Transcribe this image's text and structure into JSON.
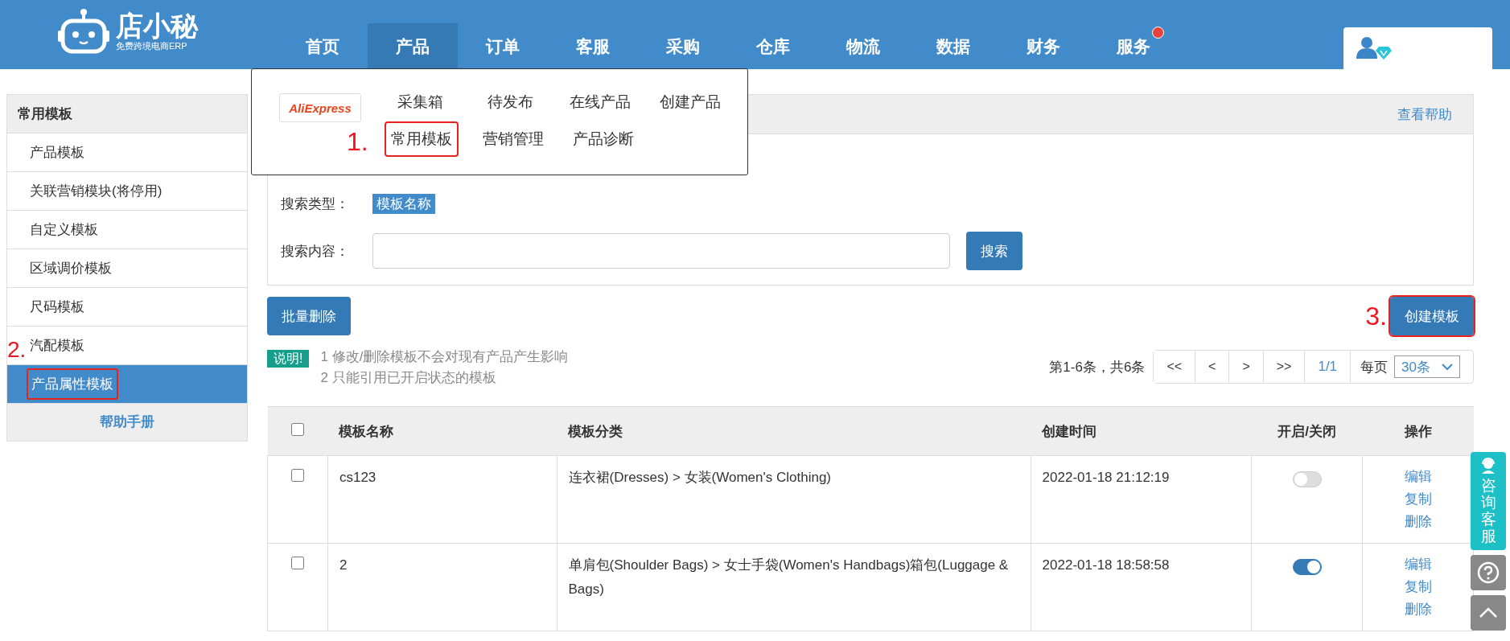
{
  "logo": {
    "name": "店小秘",
    "tagline": "免费跨境电商ERP"
  },
  "nav": [
    {
      "label": "首页",
      "selected": false,
      "dot": false
    },
    {
      "label": "产品",
      "selected": true,
      "dot": false
    },
    {
      "label": "订单",
      "selected": false,
      "dot": false
    },
    {
      "label": "客服",
      "selected": false,
      "dot": false
    },
    {
      "label": "采购",
      "selected": false,
      "dot": false
    },
    {
      "label": "仓库",
      "selected": false,
      "dot": false
    },
    {
      "label": "物流",
      "selected": false,
      "dot": false
    },
    {
      "label": "数据",
      "selected": false,
      "dot": false
    },
    {
      "label": "财务",
      "selected": false,
      "dot": false
    },
    {
      "label": "服务",
      "selected": false,
      "dot": true
    }
  ],
  "dropdown": {
    "brand": "AliExpress",
    "annotation": "1.",
    "rows": [
      [
        {
          "label": "采集箱",
          "annotated": false
        },
        {
          "label": "待发布",
          "annotated": false
        },
        {
          "label": "在线产品",
          "annotated": false
        },
        {
          "label": "创建产品",
          "annotated": false
        }
      ],
      [
        {
          "label": "常用模板",
          "annotated": true
        },
        {
          "label": "营销管理",
          "annotated": false
        },
        {
          "label": "产品诊断",
          "annotated": false
        }
      ]
    ]
  },
  "sidebar": {
    "title": "常用模板",
    "annotation": "2.",
    "footer": "帮助手册",
    "items": [
      {
        "label": "产品模板",
        "selected": false,
        "annotated": false
      },
      {
        "label": "关联营销模块(将停用)",
        "selected": false,
        "annotated": false
      },
      {
        "label": "自定义模板",
        "selected": false,
        "annotated": false
      },
      {
        "label": "区域调价模板",
        "selected": false,
        "annotated": false
      },
      {
        "label": "尺码模板",
        "selected": false,
        "annotated": false
      },
      {
        "label": "汽配模板",
        "selected": false,
        "annotated": false
      },
      {
        "label": "产品属性模板",
        "selected": true,
        "annotated": true
      }
    ]
  },
  "panel": {
    "help_link": "查看帮助",
    "search_type_label": "搜索类型：",
    "search_type_value": "模板名称",
    "search_content_label": "搜索内容：",
    "search_button": "搜索"
  },
  "actions": {
    "batch_delete": "批量删除",
    "create": "创建模板",
    "create_annotated": true,
    "annotation": "3."
  },
  "notice": {
    "badge": "说明!",
    "lines": [
      "1 修改/删除模板不会对现有产品产生影响",
      "2 只能引用已开启状态的模板"
    ]
  },
  "pagination": {
    "summary": "第1-6条，共6条",
    "buttons": [
      "<<",
      "<",
      ">",
      ">>"
    ],
    "page": "1/1",
    "per_page_label": "每页",
    "per_page": "30条"
  },
  "table": {
    "all_checked": false,
    "columns": [
      "模板名称",
      "模板分类",
      "创建时间",
      "开启/关闭",
      "操作"
    ],
    "rows": [
      {
        "checked": false,
        "name": "cs123",
        "category": "连衣裙(Dresses) > 女装(Women's Clothing)",
        "created": "2022-01-18 21:12:19",
        "enabled": false,
        "actions": [
          "编辑",
          "复制",
          "删除"
        ]
      },
      {
        "checked": false,
        "name": "2",
        "category": "单肩包(Shoulder Bags) > 女士手袋(Women's Handbags)箱包(Luggage & Bags)",
        "created": "2022-01-18 18:58:58",
        "enabled": true,
        "actions": [
          "编辑",
          "复制",
          "删除"
        ]
      }
    ]
  },
  "float": {
    "consult": "咨询客服"
  }
}
